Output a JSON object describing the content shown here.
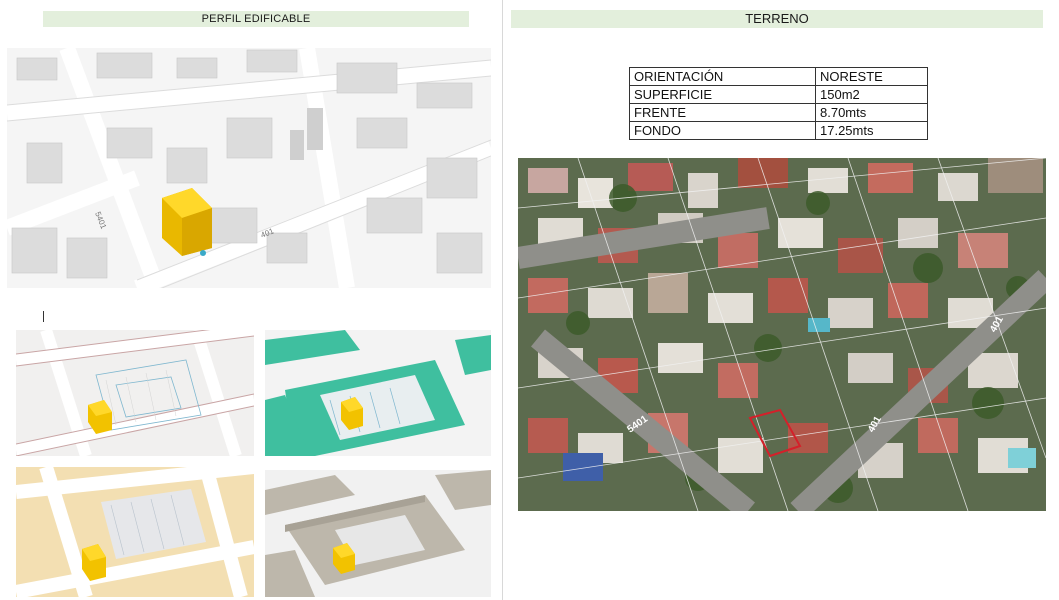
{
  "left_section": {
    "title": "PERFIL EDIFICABLE"
  },
  "right_section": {
    "title": "TERRENO"
  },
  "property_table": {
    "rows": [
      {
        "label": "ORIENTACIÓN",
        "value": "NORESTE"
      },
      {
        "label": "SUPERFICIE",
        "value": "150m2"
      },
      {
        "label": "FRENTE",
        "value": "8.70mts"
      },
      {
        "label": "FONDO",
        "value": "17.25mts"
      }
    ]
  },
  "main_map": {
    "street_a": "5401",
    "street_b": "401"
  },
  "aerial": {
    "street_a": "5401",
    "street_b": "401",
    "street_c": "401"
  },
  "colors": {
    "header_bg": "#e3efdc",
    "building_highlight": "#f2c200",
    "lot_outline": "#d4202a",
    "teal_zone": "#3fbf9f",
    "beige_zone": "#f3dfb2",
    "volume_gray": "#bdb7ab"
  }
}
